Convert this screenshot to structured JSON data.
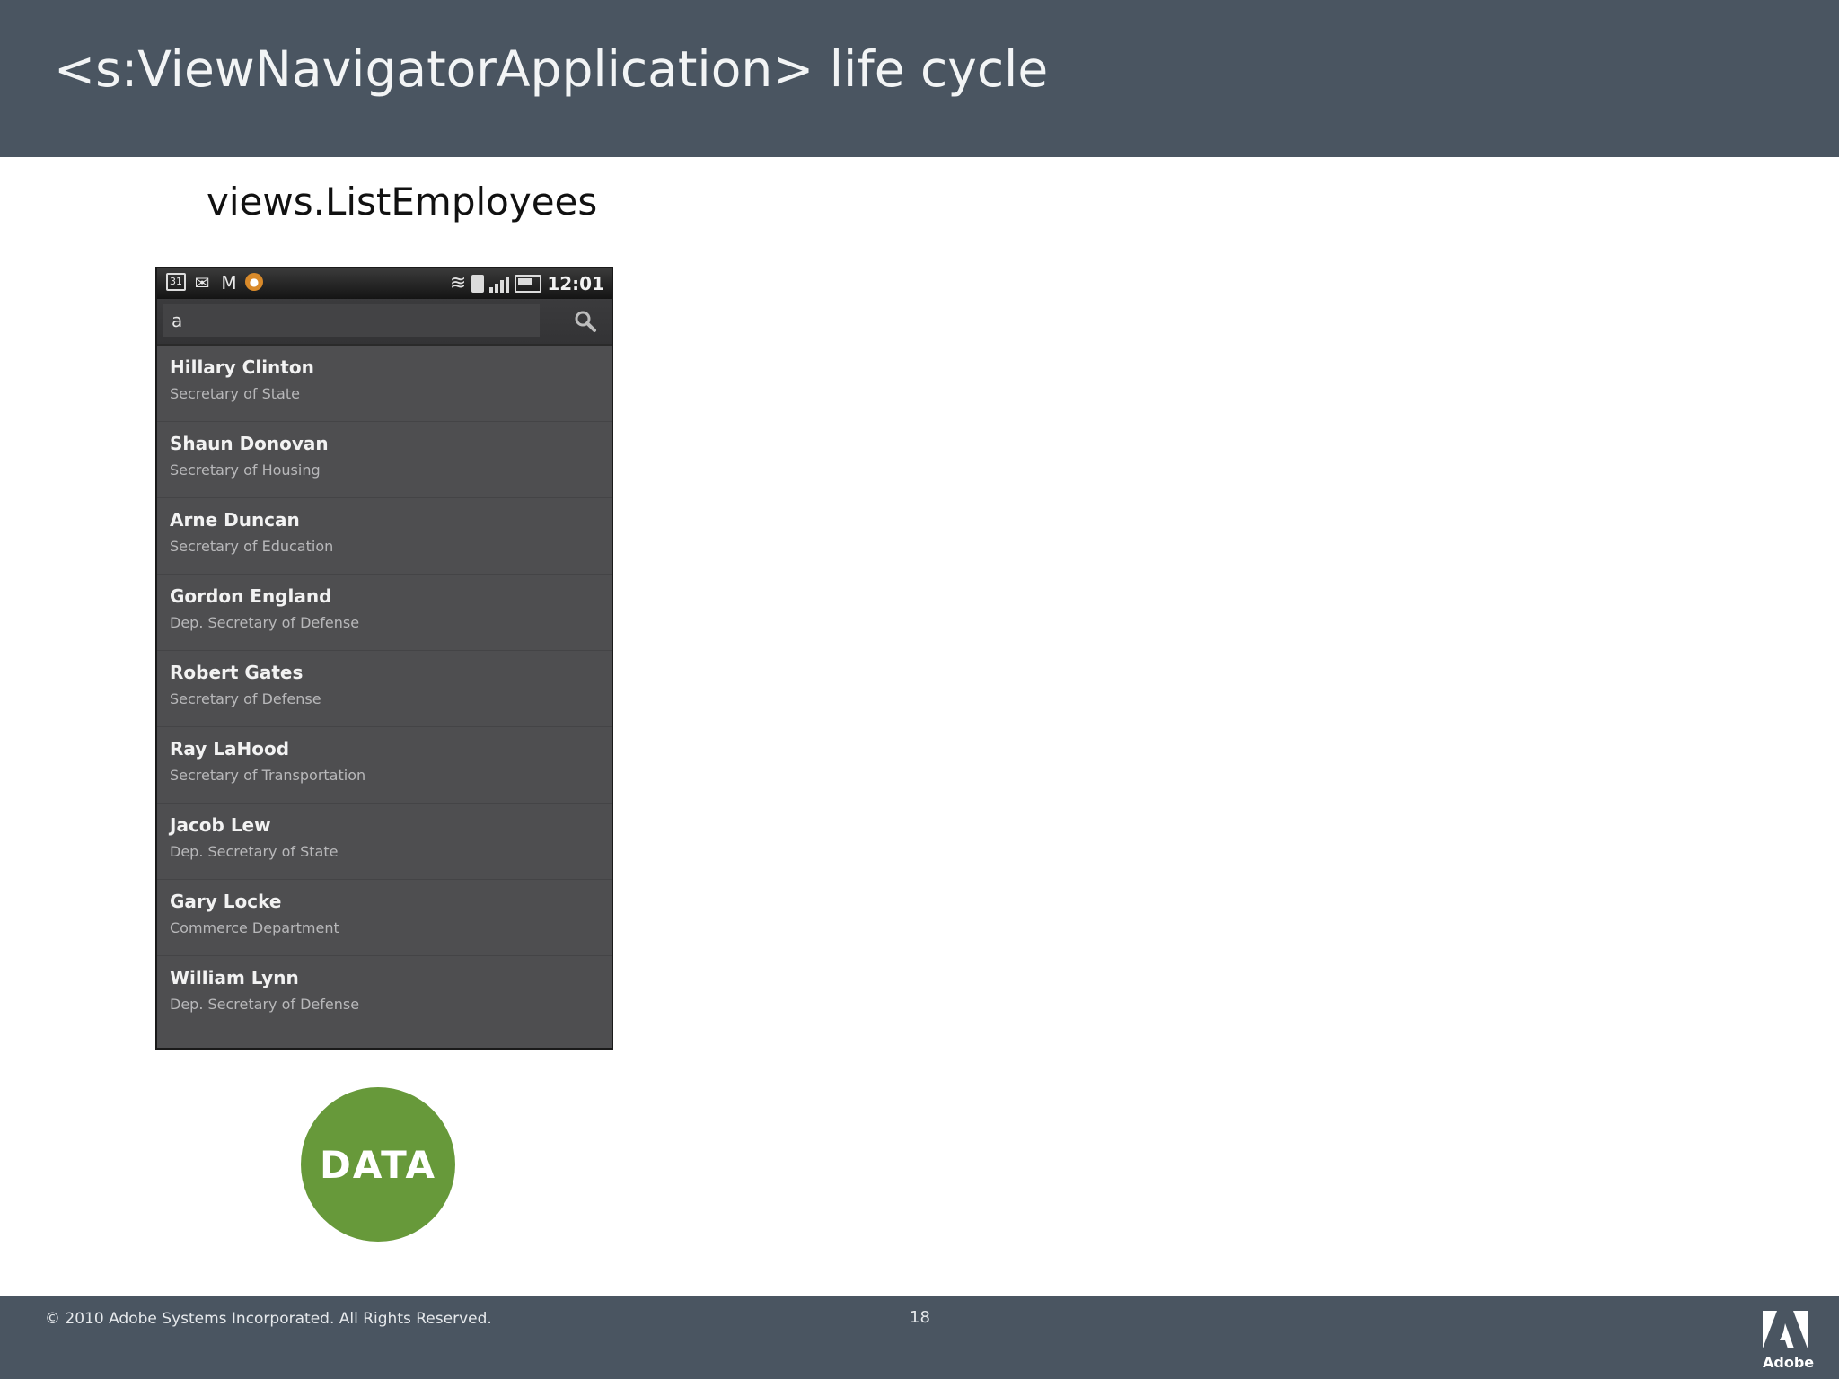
{
  "header": {
    "title": "<s:ViewNavigatorApplication> life cycle"
  },
  "view_label": "views.ListEmployees",
  "phone": {
    "status_bar": {
      "clock": "12:01"
    },
    "search": {
      "value": "a"
    },
    "employees": [
      {
        "name": "Hillary Clinton",
        "title": "Secretary of State"
      },
      {
        "name": "Shaun Donovan",
        "title": "Secretary of Housing"
      },
      {
        "name": "Arne Duncan",
        "title": "Secretary of Education"
      },
      {
        "name": "Gordon England",
        "title": "Dep. Secretary of Defense"
      },
      {
        "name": "Robert Gates",
        "title": "Secretary of Defense"
      },
      {
        "name": "Ray LaHood",
        "title": "Secretary of Transportation"
      },
      {
        "name": "Jacob Lew",
        "title": "Dep. Secretary of State"
      },
      {
        "name": "Gary Locke",
        "title": "Commerce Department"
      },
      {
        "name": "William Lynn",
        "title": "Dep. Secretary of Defense"
      }
    ]
  },
  "data_badge": {
    "label": "DATA",
    "color": "#67993a"
  },
  "footer": {
    "copyright": "© 2010 Adobe Systems Incorporated.  All Rights Reserved.",
    "page_number": "18",
    "logo_text": "Adobe"
  },
  "colors": {
    "header_bg": "#4a5561",
    "phone_bg": "#4e4e50"
  }
}
